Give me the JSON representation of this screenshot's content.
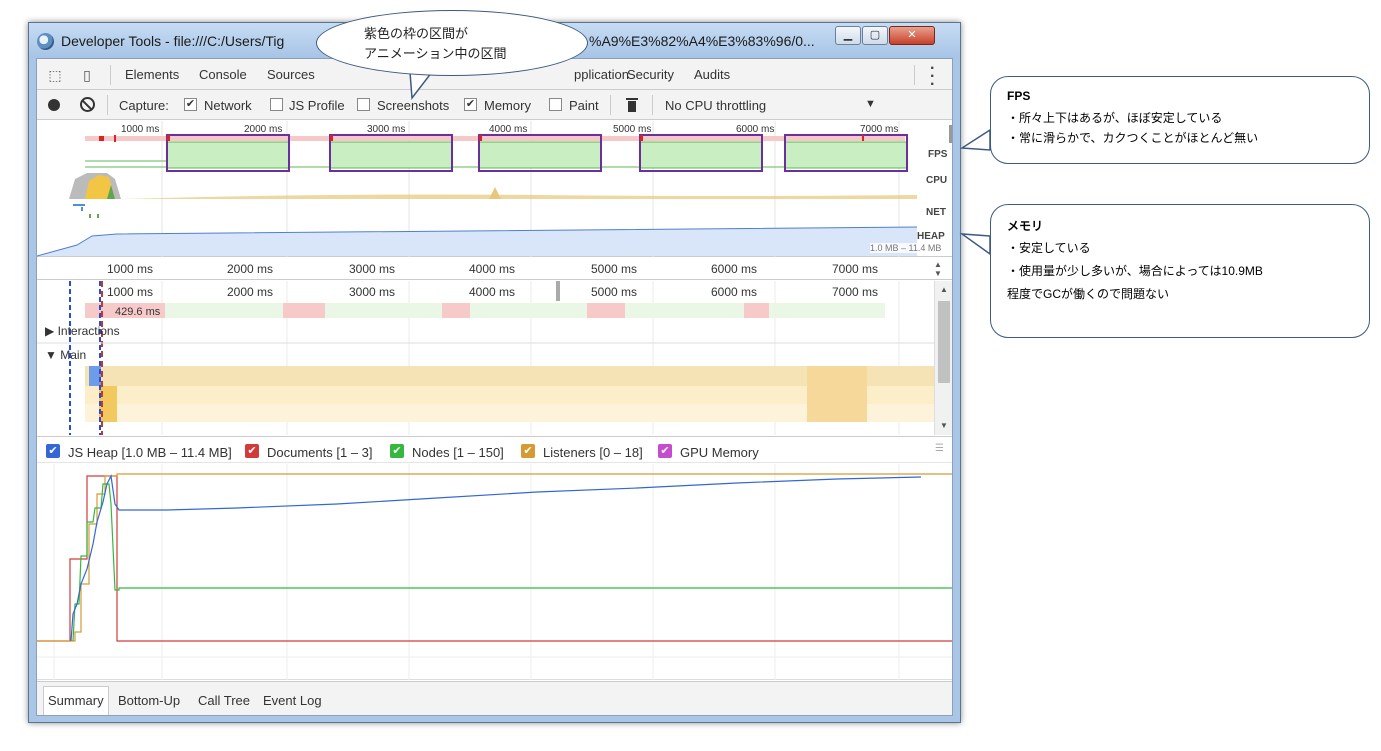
{
  "window": {
    "title": "Developer Tools - file:///C:/Users/Tig",
    "title_tail": "%A9%E3%82%A4%E3%83%96/0...",
    "min_icon": "minimize-icon",
    "max_icon": "maximize-icon",
    "close_icon": "close-icon"
  },
  "tabs": [
    "Elements",
    "Console",
    "Sources",
    "pplication",
    "Security",
    "Audits"
  ],
  "capture": {
    "label": "Capture:",
    "options": [
      {
        "label": "Network",
        "checked": true
      },
      {
        "label": "JS Profile",
        "checked": false
      },
      {
        "label": "Screenshots",
        "checked": false
      },
      {
        "label": "Memory",
        "checked": true
      },
      {
        "label": "Paint",
        "checked": false
      }
    ],
    "throttling": "No CPU throttling"
  },
  "overview": {
    "ticks": [
      "1000 ms",
      "2000 ms",
      "3000 ms",
      "4000 ms",
      "5000 ms",
      "6000 ms",
      "7000 ms"
    ],
    "lanes": [
      "FPS",
      "CPU",
      "NET",
      "HEAP"
    ],
    "heap_range": "1.0 MB – 11.4 MB"
  },
  "ruler": {
    "ticks": [
      "1000 ms",
      "2000 ms",
      "3000 ms",
      "4000 ms",
      "5000 ms",
      "6000 ms",
      "7000 ms"
    ]
  },
  "flame": {
    "ticks": [
      "1000 ms",
      "2000 ms",
      "3000 ms",
      "4000 ms",
      "5000 ms",
      "6000 ms",
      "7000 ms"
    ],
    "duration": "429.6 ms",
    "interactions": "Interactions",
    "main": "Main"
  },
  "counters": {
    "items": [
      {
        "label": "JS Heap [1.0 MB – 11.4 MB]",
        "color": "#3367d6"
      },
      {
        "label": "Documents [1 – 3]",
        "color": "#d33b3b"
      },
      {
        "label": "Nodes [1 – 150]",
        "color": "#36b83e"
      },
      {
        "label": "Listeners [0 – 18]",
        "color": "#d69a34"
      },
      {
        "label": "GPU Memory",
        "color": "#c64ccf"
      }
    ]
  },
  "bottom_tabs": [
    "Summary",
    "Bottom-Up",
    "Call Tree",
    "Event Log"
  ],
  "callouts": {
    "bubble": [
      "紫色の枠の区間が",
      "アニメーション中の区間"
    ],
    "fps": {
      "title": "FPS",
      "lines": [
        "・所々上下はあるが、ほぼ安定している",
        "・常に滑らかで、カクつくことがほとんど無い"
      ]
    },
    "memory": {
      "title": "メモリ",
      "lines": [
        "・安定している",
        "・使用量が少し多いが、場合によっては10.9MB",
        "程度でGCが働くので問題ない"
      ]
    }
  }
}
